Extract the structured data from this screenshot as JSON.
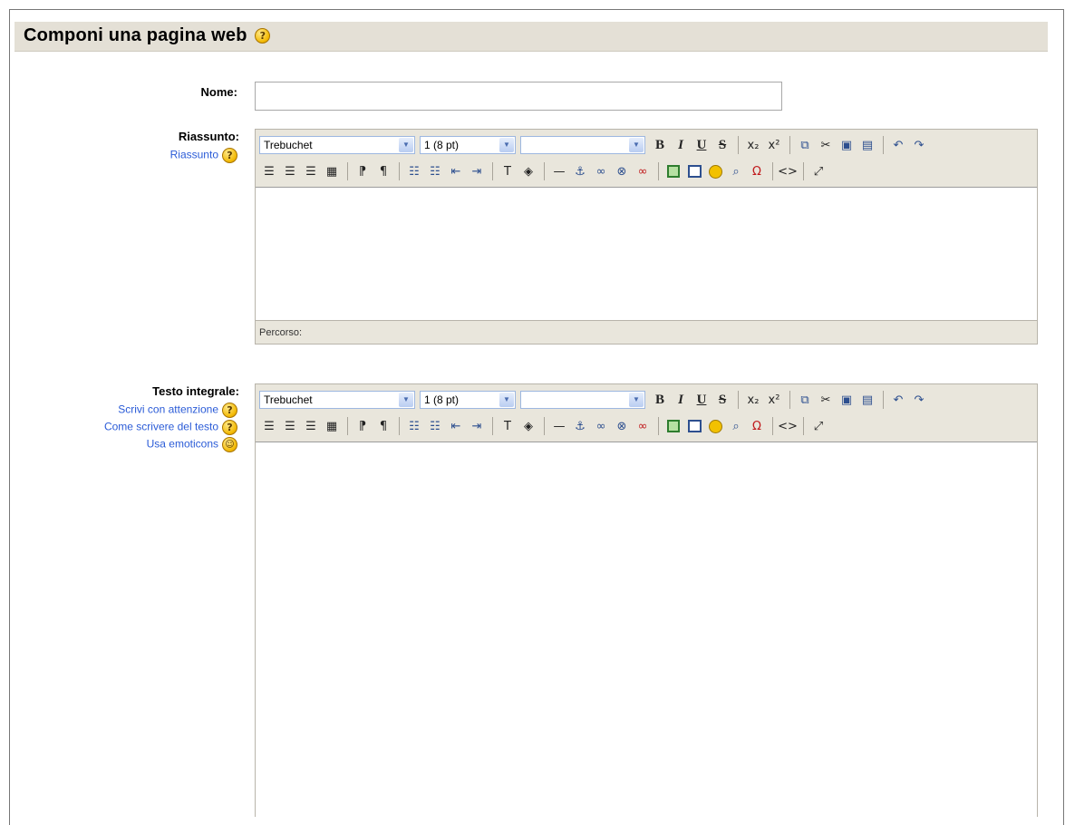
{
  "page": {
    "title": "Componi una pagina web"
  },
  "form": {
    "name_label": "Nome:",
    "name_value": "",
    "summary_label": "Riassunto:",
    "summary_links": [
      {
        "label": "Riassunto",
        "icon": "help-icon"
      }
    ],
    "fulltext_label": "Testo integrale:",
    "fulltext_links": [
      {
        "label": "Scrivi con attenzione",
        "icon": "help-icon"
      },
      {
        "label": "Come scrivere del testo",
        "icon": "help-icon"
      },
      {
        "label": "Usa emoticons",
        "icon": "smiley-icon"
      }
    ]
  },
  "editor": {
    "font_family": "Trebuchet",
    "font_size": "1 (8 pt)",
    "style": "",
    "status_label": "Percorso:",
    "toolbar_row1": [
      "bold",
      "italic",
      "underline",
      "strikethrough",
      "subscript",
      "superscript",
      "copy",
      "cut",
      "paste",
      "paste-word",
      "undo",
      "redo"
    ],
    "toolbar_row2": [
      "align-left",
      "align-center",
      "align-right",
      "justify",
      "ltr",
      "rtl",
      "ordered-list",
      "unordered-list",
      "outdent",
      "indent",
      "text-color",
      "background-color",
      "horizontal-rule",
      "anchor",
      "insert-link",
      "unlink",
      "remove-link",
      "insert-image",
      "insert-table",
      "insert-smiley",
      "find-replace",
      "special-chars",
      "html-source",
      "fullscreen"
    ]
  },
  "colors": {
    "heading_bg": "#e4e0d6",
    "toolbar_bg": "#e9e6dc",
    "link_color": "#2a5bd7",
    "help_icon": "#f2b800"
  }
}
